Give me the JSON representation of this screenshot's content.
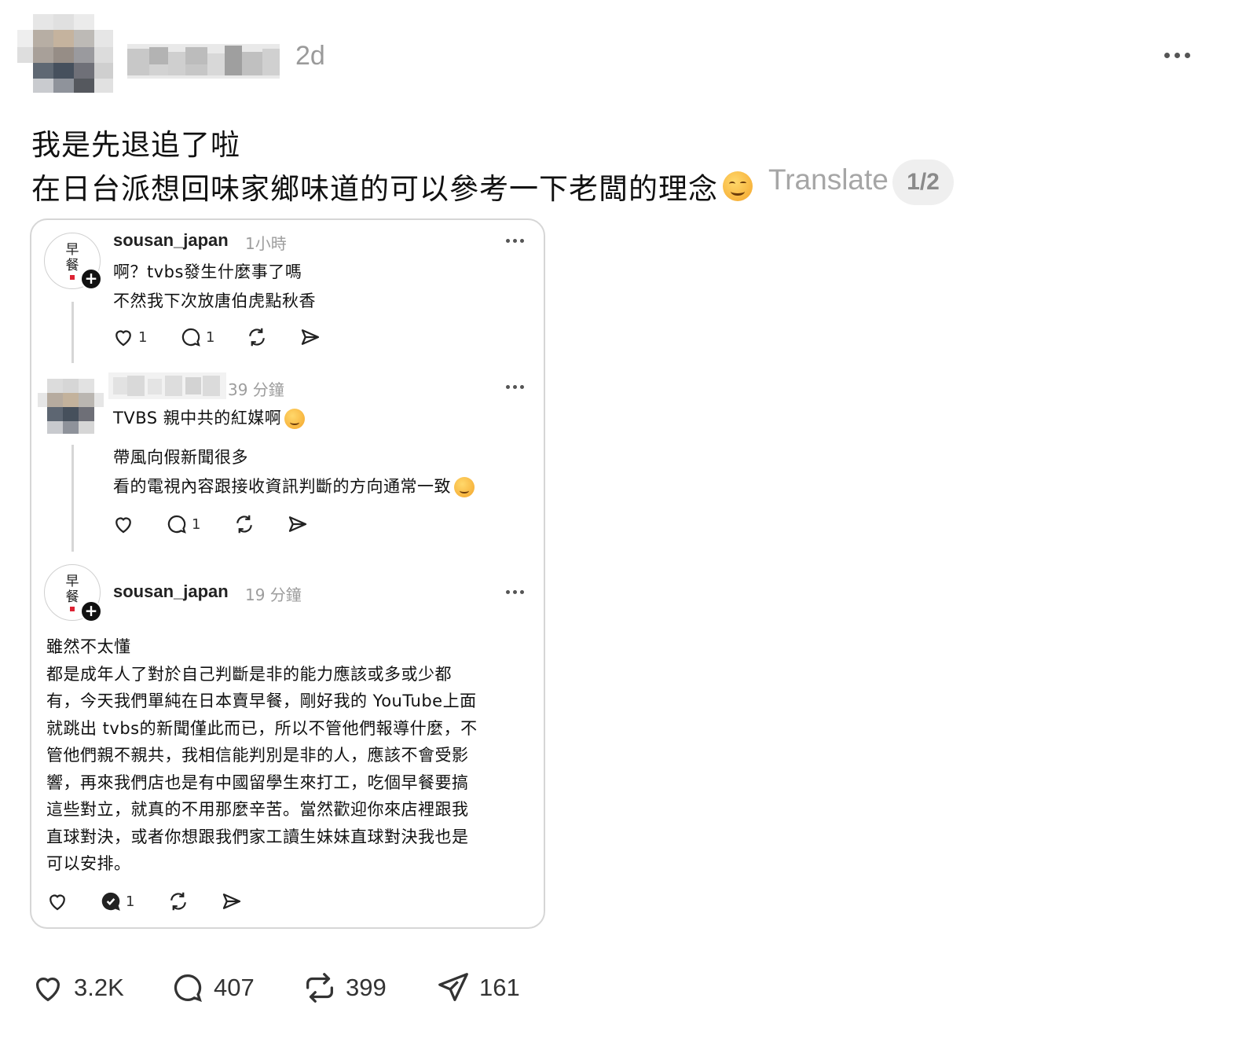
{
  "post": {
    "time": "2d",
    "line1": "我是先退追了啦",
    "line2": "在日台派想回味家鄉味道的可以參考一下老闆的理念",
    "translate": "Translate",
    "page_indicator": "1/2"
  },
  "embedded": {
    "comment1": {
      "logo_text": [
        "早",
        "餐"
      ],
      "username": "sousan_japan",
      "time": "1小時",
      "lines": [
        "啊？tvbs發生什麼事了嗎",
        "不然我下次放唐伯虎點秋香"
      ],
      "likes": "1",
      "replies": "1"
    },
    "comment2": {
      "time": "39 分鐘",
      "lines": [
        "TVBS 親中共的紅媒啊",
        "帶風向假新聞很多",
        "看的電視內容跟接收資訊判斷的方向通常一致"
      ],
      "replies": "1"
    },
    "comment3": {
      "logo_text": [
        "早",
        "餐"
      ],
      "username": "sousan_japan",
      "time": "19 分鐘",
      "body": "雖然不太懂\n都是成年人了對於自己判斷是非的能力應該或多或少都\n有，今天我們單純在日本賣早餐，剛好我的 YouTube上面\n就跳出 tvbs的新聞僅此而已，所以不管他們報導什麼，不\n管他們親不親共，我相信能判別是非的人，應該不會受影\n響，再來我們店也是有中國留學生來打工，吃個早餐要搞\n這些對立，就真的不用那麼辛苦。當然歡迎你來店裡跟我\n直球對決，或者你想跟我們家工讀生妹妹直球對決我也是\n可以安排。",
      "replies": "1"
    }
  },
  "actions": {
    "likes": "3.2K",
    "comments": "407",
    "reposts": "399",
    "shares": "161"
  }
}
